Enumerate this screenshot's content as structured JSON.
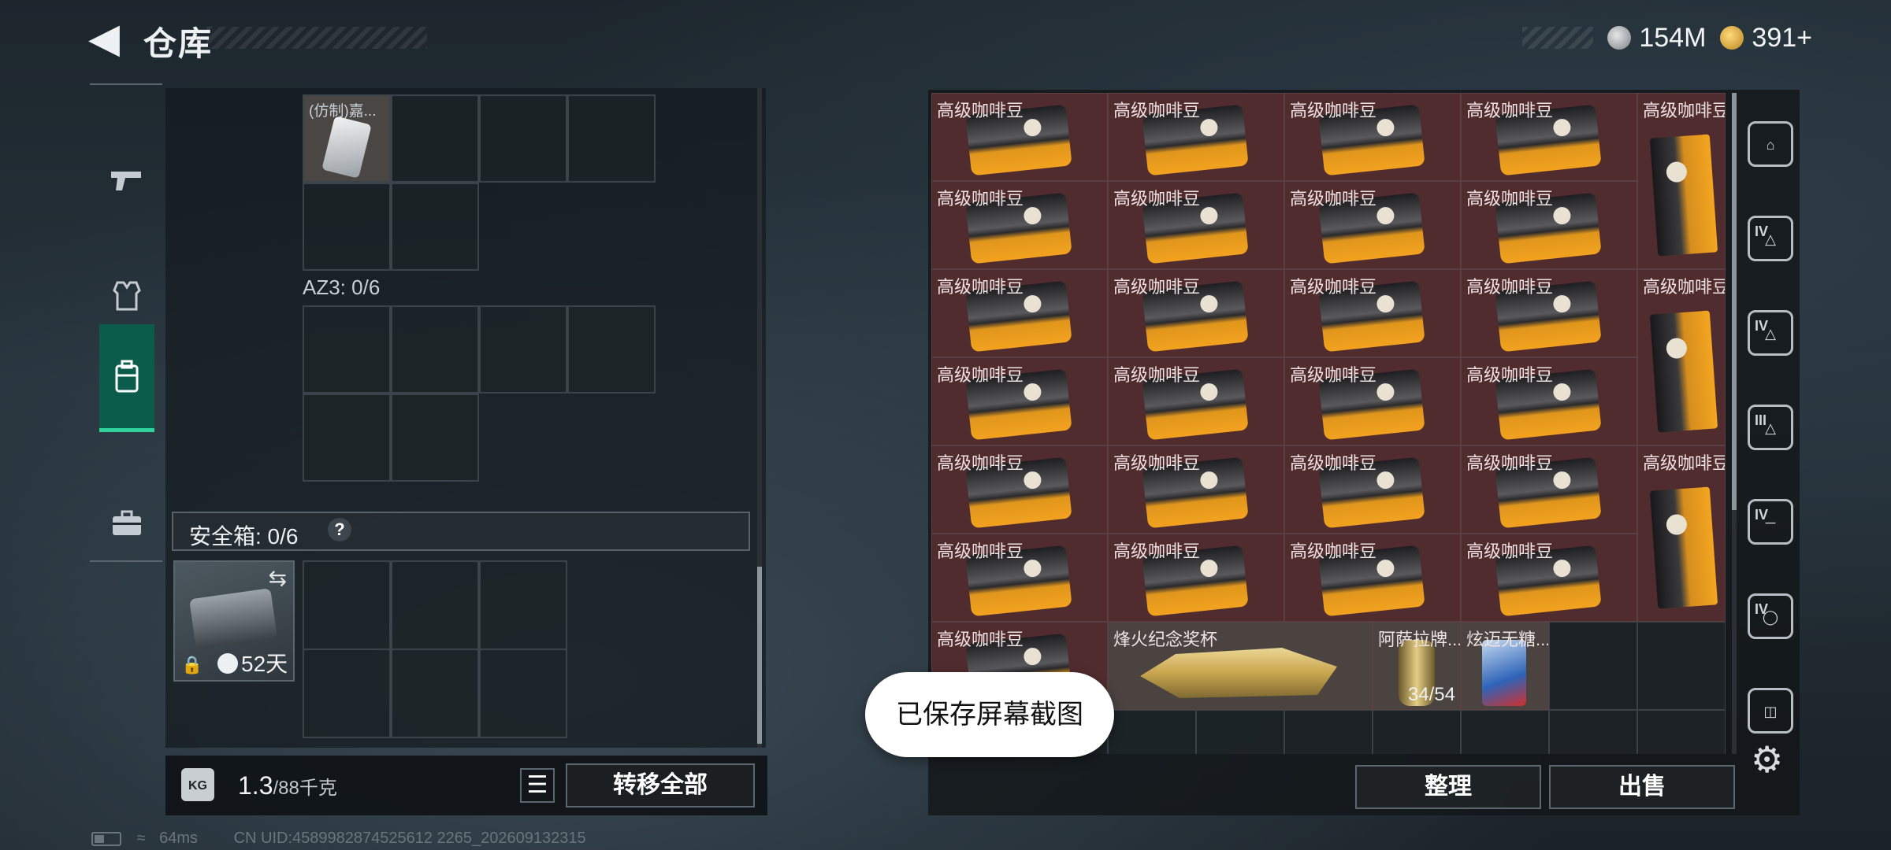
{
  "header": {
    "title": "仓库",
    "currencies": [
      {
        "icon": "silver-coin-icon",
        "value": "154M"
      },
      {
        "icon": "gold-coin-icon",
        "value": "391+"
      }
    ]
  },
  "sidenav": {
    "items": [
      {
        "name": "weapons",
        "icon": "pistol-icon"
      },
      {
        "name": "armor",
        "icon": "vest-icon"
      },
      {
        "name": "backpack",
        "icon": "backpack-icon",
        "active": true
      },
      {
        "name": "toolbox",
        "icon": "briefcase-icon"
      }
    ]
  },
  "left": {
    "slot_item_label": "(仿制)嘉...",
    "az3_label": "AZ3: 0/6",
    "safebox_label": "安全箱: 0/6",
    "safebox_days": "52天",
    "weight_value": "1.3",
    "weight_capacity": "/88千克",
    "kg_icon": "KG",
    "transfer_button": "转移全部"
  },
  "storage": {
    "coffee_label": "高级咖啡豆",
    "special_items": [
      {
        "name": "烽火纪念奖杯",
        "icon": "trophy-icon"
      },
      {
        "name": "阿萨拉牌...",
        "icon": "medal-icon",
        "count": "34/54"
      },
      {
        "name": "炫迈无糖...",
        "icon": "gum-pack-icon"
      }
    ]
  },
  "buttons": {
    "sort": "整理",
    "sell": "出售"
  },
  "filters": [
    {
      "icon": "all-items-icon",
      "tier": ""
    },
    {
      "icon": "helmet-tier-icon",
      "tier": "IV"
    },
    {
      "icon": "armor-tier-icon",
      "tier": "IV"
    },
    {
      "icon": "rig-tier-icon",
      "tier": "III"
    },
    {
      "icon": "weapon-tier-icon",
      "tier": "IV"
    },
    {
      "icon": "attachment-tier-icon",
      "tier": "IV"
    },
    {
      "icon": "ammo-box-icon",
      "tier": ""
    },
    {
      "icon": "gear-icon",
      "tier": ""
    }
  ],
  "toast": "已保存屏幕截图",
  "status": {
    "ping": "64ms",
    "uid": "CN UID:4589982874525612 2265_202609132315"
  },
  "colors": {
    "accent": "#2fd39b",
    "item_bg": "#512c2f",
    "panel": "#121619"
  }
}
